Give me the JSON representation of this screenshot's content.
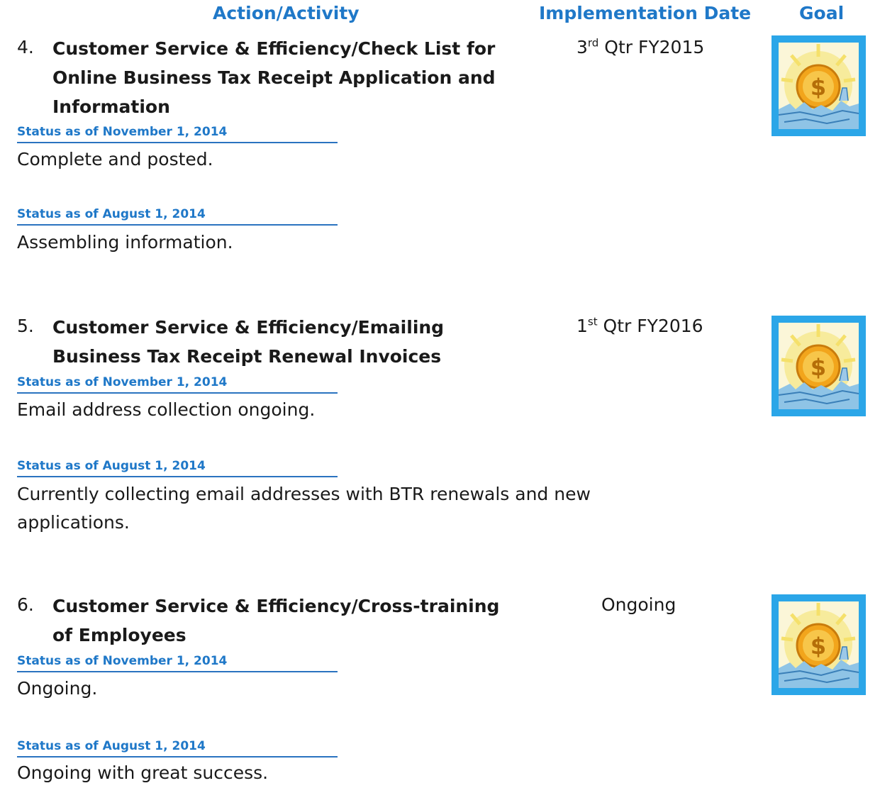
{
  "header": {
    "action": "Action/Activity",
    "date": "Implementation Date",
    "goal": "Goal"
  },
  "items": [
    {
      "number": "4.",
      "title": "Customer Service & Efficiency/Check List for Online Business Tax Receipt Application and Information",
      "date_ordinal": "3",
      "date_suffix": "rd",
      "date_rest": " Qtr FY2015",
      "goal_icon": "sun-dollar-coin-icon",
      "statuses": [
        {
          "heading": "Status as of November 1, 2014",
          "text": "Complete and posted."
        },
        {
          "heading": "Status as of August 1, 2014",
          "text": "Assembling information."
        }
      ]
    },
    {
      "number": "5.",
      "title": "Customer Service & Efficiency/Emailing Business Tax Receipt Renewal Invoices",
      "date_ordinal": "1",
      "date_suffix": "st",
      "date_rest": " Qtr FY2016",
      "goal_icon": "sun-dollar-coin-icon",
      "statuses": [
        {
          "heading": "Status as of November 1, 2014",
          "text": "Email address collection ongoing."
        },
        {
          "heading": "Status as of August 1, 2014",
          "text": "Currently collecting email addresses with BTR renewals and new applications."
        }
      ]
    },
    {
      "number": "6.",
      "title": "Customer Service & Efficiency/Cross-training of Employees",
      "date_text": "Ongoing",
      "goal_icon": "sun-dollar-coin-icon",
      "statuses": [
        {
          "heading": "Status as of November 1, 2014",
          "text": "Ongoing."
        },
        {
          "heading": "Status as of August 1, 2014",
          "text": "Ongoing with great success."
        }
      ]
    }
  ],
  "colors": {
    "heading_blue": "#1f78c8",
    "icon_frame": "#2ba6e8",
    "icon_sun": "#f6e38a",
    "icon_coin": "#f2a51c"
  }
}
